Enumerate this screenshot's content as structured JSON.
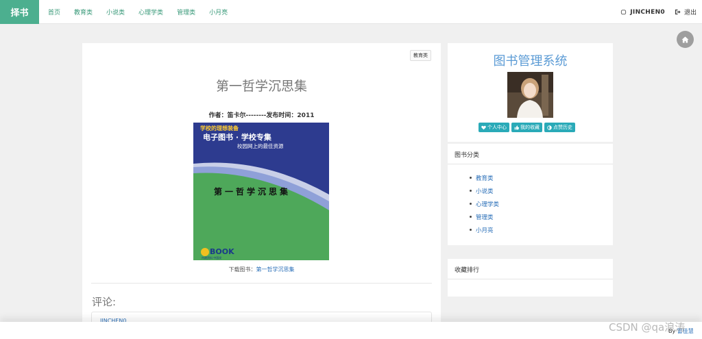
{
  "navbar": {
    "brand": "择书",
    "links": [
      "首页",
      "教育类",
      "小说类",
      "心理学类",
      "管理类",
      "小月亮"
    ],
    "user": "JINCHEN0",
    "logout": "退出"
  },
  "book": {
    "category_tag": "教育类",
    "title": "第一哲学沉思集",
    "meta": "作者：笛卡尔--------发布时间：2011",
    "cover": {
      "top_text_1": "学校的理想装备",
      "top_text_2": "电子图书 · 学校专集",
      "top_text_3": "校园网上的最佳资源",
      "center_text": "第一哲学沉思集",
      "logo_text": "BOOK",
      "logo_sub": "内建资料 中国发"
    },
    "download_label": "下载图书：",
    "download_link": "第一哲学沉思集"
  },
  "comments": {
    "heading": "评论:",
    "first_user": "JINCHEN0"
  },
  "sidebar": {
    "system_title": "图书管理系统",
    "buttons": [
      "个人中心",
      "我的收藏",
      "点赞历史"
    ],
    "category_panel": {
      "title": "图书分类",
      "items": [
        "教育类",
        "小说类",
        "心理学类",
        "管理类",
        "小月亮"
      ]
    },
    "favorites_panel": {
      "title": "收藏排行"
    }
  },
  "footer": {
    "by_label": "By",
    "by_name": "雷佳慧"
  },
  "watermark": "CSDN @qa浪涛",
  "colors": {
    "brand": "#4caf8f",
    "nav_link": "#3a9a7a",
    "link": "#2a6fb8",
    "title_blue": "#5b9bd5",
    "button": "#2aaab8"
  }
}
